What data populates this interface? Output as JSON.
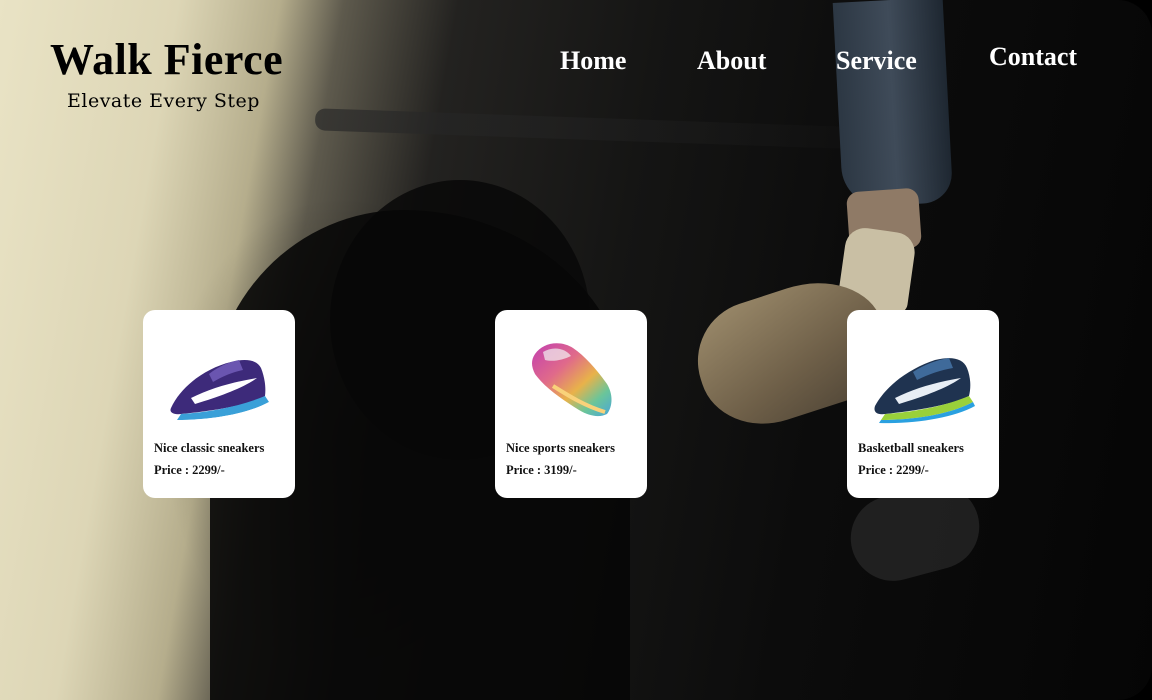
{
  "brand": {
    "title": "Walk Fierce",
    "tagline": "Elevate Every Step"
  },
  "nav": {
    "items": [
      "Home",
      "About",
      "Service",
      "Contact"
    ]
  },
  "products": [
    {
      "name": "Nice classic sneakers",
      "price": "Price : 2299/-",
      "icon": "purple-sneaker-image"
    },
    {
      "name": "Nice sports sneakers",
      "price": "Price : 3199/-",
      "icon": "rainbow-sneaker-image"
    },
    {
      "name": "Basketball sneakers",
      "price": "Price : 2299/-",
      "icon": "blue-sneaker-image"
    }
  ],
  "colors": {
    "card_bg": "#ffffff",
    "nav_text": "#ffffff",
    "brand_text": "#000000"
  }
}
